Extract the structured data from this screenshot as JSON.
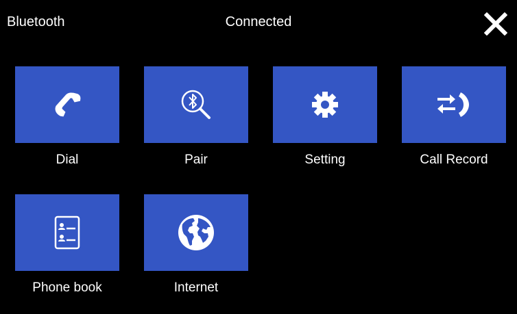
{
  "header": {
    "title": "Bluetooth",
    "status": "Connected",
    "close_icon": "close-icon"
  },
  "tiles": [
    {
      "label": "Dial",
      "icon": "phone-icon"
    },
    {
      "label": "Pair",
      "icon": "bluetooth-search-icon"
    },
    {
      "label": "Setting",
      "icon": "gear-icon"
    },
    {
      "label": "Call Record",
      "icon": "call-record-icon"
    },
    {
      "label": "Phone book",
      "icon": "contacts-icon"
    },
    {
      "label": "Internet",
      "icon": "globe-icon"
    }
  ],
  "colors": {
    "background": "#000000",
    "tile": "#3456c4",
    "text": "#ffffff"
  }
}
